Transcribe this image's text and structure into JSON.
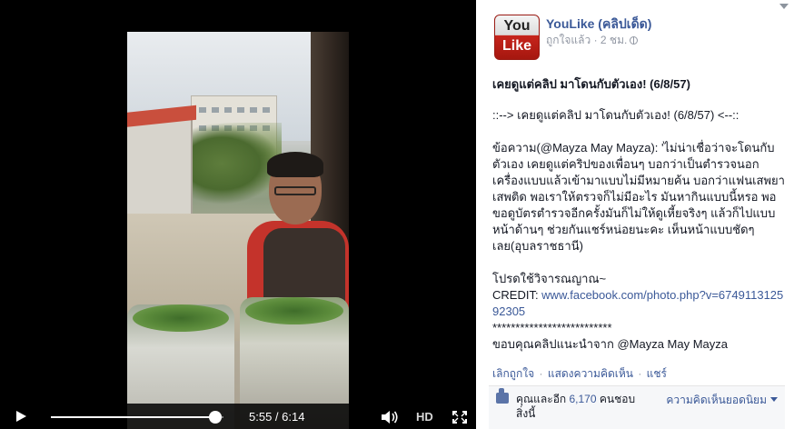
{
  "video": {
    "time_display": "5:55 / 6:14",
    "progress": 0.954,
    "hd_label": "HD"
  },
  "page": {
    "logo_text_top": "You",
    "logo_text_bottom": "Like",
    "name": "YouLike (คลิปเด็ด)",
    "liked_label": "ถูกใจแล้ว",
    "dot": " · ",
    "time_ago": "2 ชม."
  },
  "post": {
    "title": "เคยดูแต่คลิป มาโดนกับตัวเอง! (6/8/57)",
    "intro": "::--> เคยดูแต่คลิป มาโดนกับตัวเอง! (6/8/57) <--::",
    "message": "ข้อความ(@Mayza May Mayza): 'ไม่น่าเชื่อว่าจะโดนกับตัวเอง เคยดูแต่คริปของเพื่อนๆ บอกว่าเป็นตำรวจนอกเครื่องแบบแล้วเข้ามาแบบไม่มีหมายค้น บอกว่าแฟนเสพยาเสพติด พอเราให้ตรวจก็ไม่มีอะไร มันหากินแบบนี้หรอ พอขอดูบัตรตำรวจอีกครั้งมันก็ไม่ให้ดูเหี้ยจริงๆ แล้วก็ไปแบบหน้าด้านๆ ช่วยกันแชร์หน่อยนะคะ เห็นหน้าแบบชัดๆเลย(อุบลราชธานี)",
    "judgement": "โปรดใช้วิจารณญาณ~",
    "credit_label": "CREDIT: ",
    "credit_url": "www.facebook.com/photo.php?v=674911312592305",
    "stars": "**************************",
    "thanks": "ขอบคุณคลิปแนะนำจาก @Mayza May Mayza"
  },
  "actions": {
    "unlike": "เลิกถูกใจ",
    "comment": "แสดงความคิดเห็น",
    "share": "แชร์",
    "sep": " · "
  },
  "likes": {
    "prefix": "คุณและอีก ",
    "count": "6,170",
    "suffix": " คนชอบสิ่งนี้",
    "sort_label": "ความคิดเห็นยอดนิยม"
  }
}
